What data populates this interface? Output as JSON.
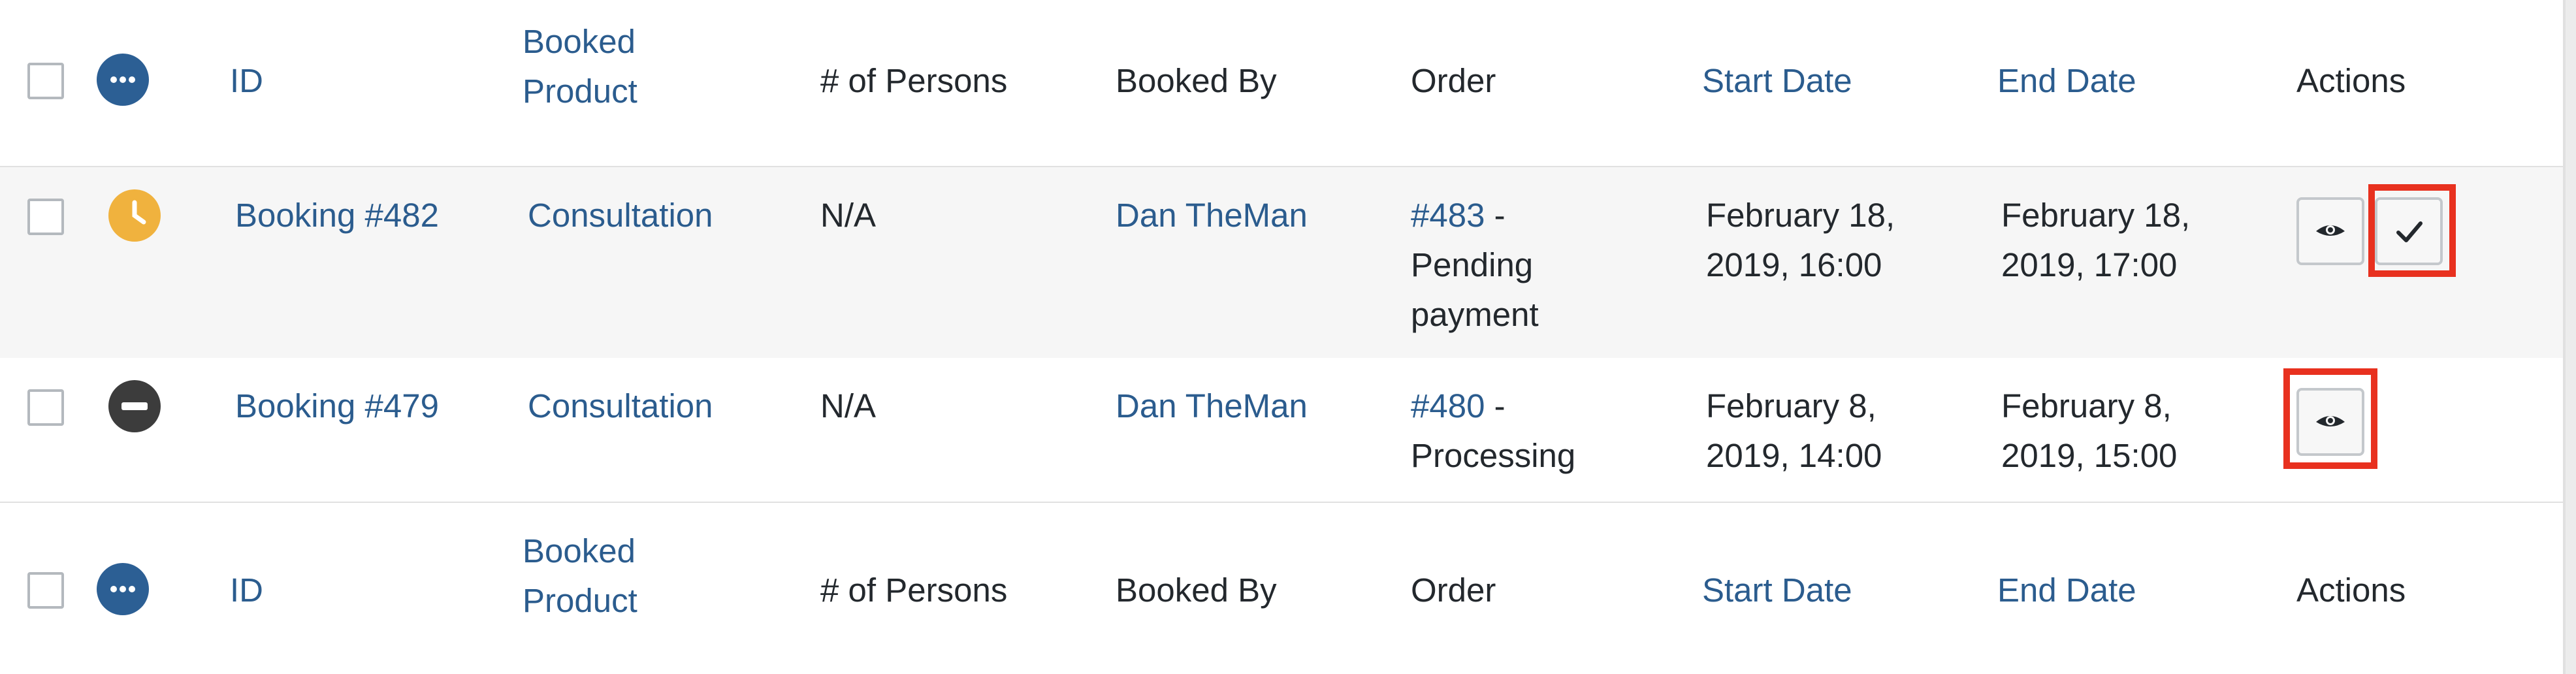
{
  "columns": {
    "id": "ID",
    "booked_product_line1": "Booked",
    "booked_product_line2": "Product",
    "persons": "# of Persons",
    "booked_by": "Booked By",
    "order": "Order",
    "start_date": "Start Date",
    "end_date": "End Date",
    "actions": "Actions"
  },
  "rows": [
    {
      "status": "pending-confirmation",
      "status_icon": "clock-icon",
      "id": "Booking #482",
      "product": "Consultation",
      "persons": "N/A",
      "booked_by": "Dan TheMan",
      "order_number": "#483",
      "order_sep": " -",
      "order_status_line1": "Pending",
      "order_status_line2": "payment",
      "start_line1": "February 18,",
      "start_line2": "2019, 16:00",
      "end_line1": "February 18,",
      "end_line2": "2019, 17:00",
      "actions": [
        "view-icon",
        "confirm-check-icon"
      ]
    },
    {
      "status": "cancelled",
      "status_icon": "minus-circle-icon",
      "id": "Booking #479",
      "product": "Consultation",
      "persons": "N/A",
      "booked_by": "Dan TheMan",
      "order_number": "#480",
      "order_sep": " -",
      "order_status_line1": "Processing",
      "start_line1": "February 8,",
      "start_line2": "2019, 14:00",
      "end_line1": "February 8,",
      "end_line2": "2019, 15:00",
      "actions": [
        "view-icon"
      ]
    }
  ],
  "colors": {
    "link": "#2b5c8e",
    "header_status_icon": "#2c5f94",
    "pending_icon": "#f0b23e",
    "cancelled_icon": "#3c3c3c",
    "highlight": "#e8311f",
    "row_alt_bg": "#f6f6f6"
  }
}
